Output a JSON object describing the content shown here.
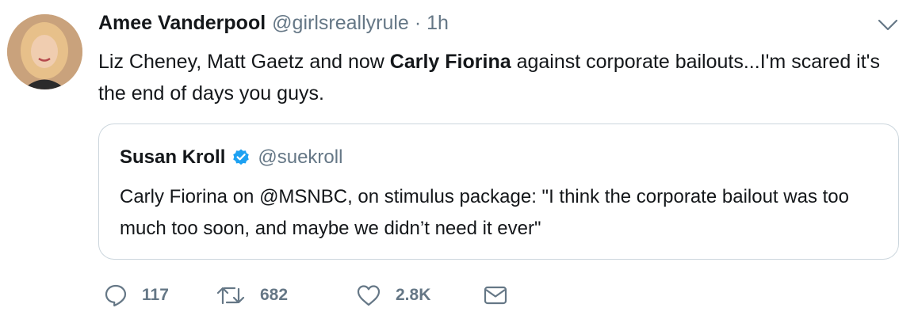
{
  "tweet": {
    "author_name": "Amee Vanderpool",
    "author_handle": "@girlsreallyrule",
    "separator": "·",
    "time": "1h",
    "text_part1": "Liz Cheney, Matt Gaetz and now ",
    "text_bold": "Carly Fiorina",
    "text_part2": " against corporate bailouts...I'm scared it's the end of days you guys."
  },
  "quoted_tweet": {
    "author_name": "Susan Kroll",
    "author_handle": "@suekroll",
    "verified": true,
    "text": "Carly Fiorina on @MSNBC, on stimulus package: \"I think the corporate bailout was too much too soon, and maybe we didn’t need it ever\""
  },
  "actions": {
    "replies": "117",
    "retweets": "682",
    "likes": "2.8K"
  },
  "icons": {
    "reply": "reply-icon",
    "retweet": "retweet-icon",
    "like": "heart-icon",
    "dm": "envelope-icon",
    "caret": "chevron-down-icon",
    "verified": "verified-badge-icon"
  },
  "colors": {
    "text": "#14171a",
    "secondary": "#657786",
    "verified": "#1da1f2",
    "border": "#ccd6dd"
  }
}
